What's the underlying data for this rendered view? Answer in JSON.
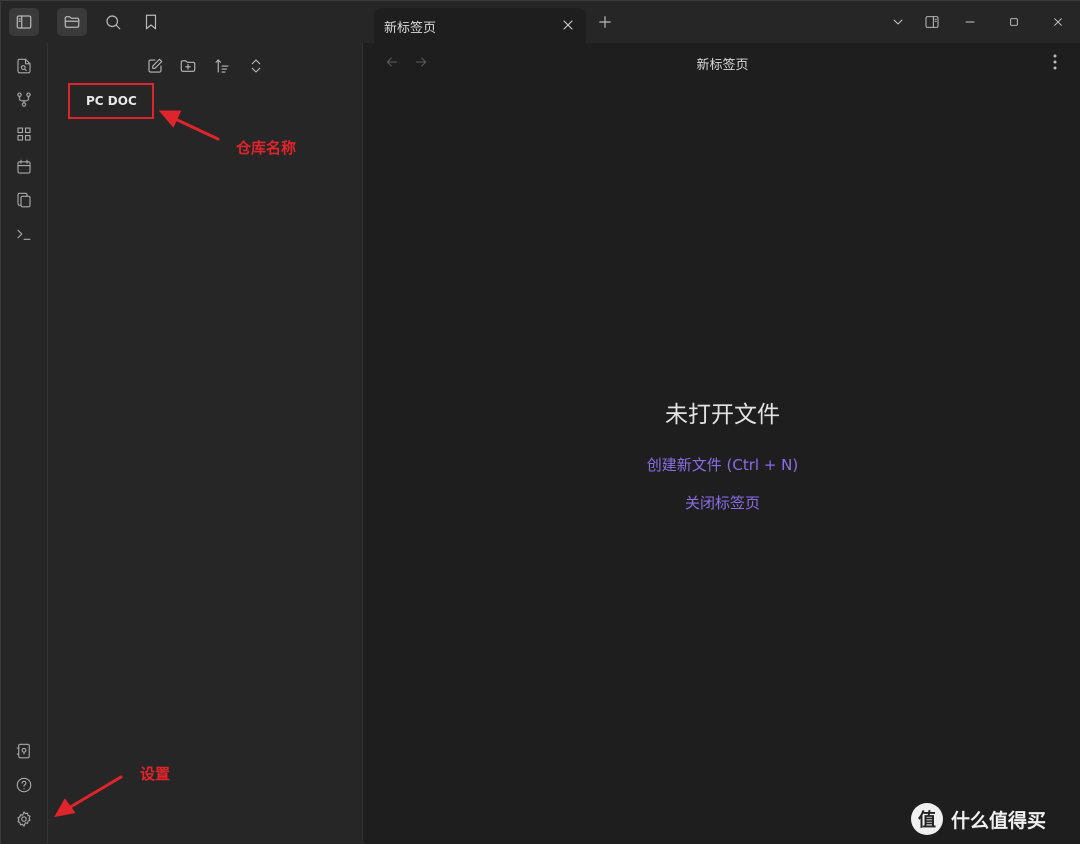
{
  "tab": {
    "title": "新标签页"
  },
  "view": {
    "title": "新标签页"
  },
  "sidebar": {
    "vault_name": "PC DOC"
  },
  "empty_state": {
    "title": "未打开文件",
    "create_action": "创建新文件 (Ctrl + N)",
    "close_action": "关闭标签页"
  },
  "annotations": {
    "vault_label": "仓库名称",
    "settings_label": "设置",
    "color": "#e0242b"
  },
  "watermark": {
    "logo_glyph": "值",
    "text": "什么值得买"
  },
  "colors": {
    "accent": "#8a6ee6",
    "background": "#1e1e1e",
    "panel": "#262626"
  },
  "icons": {
    "titlebar": [
      "sidebar-toggle-icon",
      "folder-icon",
      "search-icon",
      "bookmark-icon",
      "plus-icon",
      "chevron-down-icon",
      "split-view-icon",
      "minimize-icon",
      "maximize-icon",
      "close-icon"
    ],
    "ribbon": [
      "open-switcher-icon",
      "graph-icon",
      "canvas-icon",
      "daily-note-icon",
      "templates-icon",
      "command-palette-icon",
      "vault-switcher-icon",
      "help-icon",
      "settings-icon"
    ],
    "sidebar_tools": [
      "new-note-icon",
      "new-folder-icon",
      "sort-icon",
      "collapse-icon"
    ]
  }
}
